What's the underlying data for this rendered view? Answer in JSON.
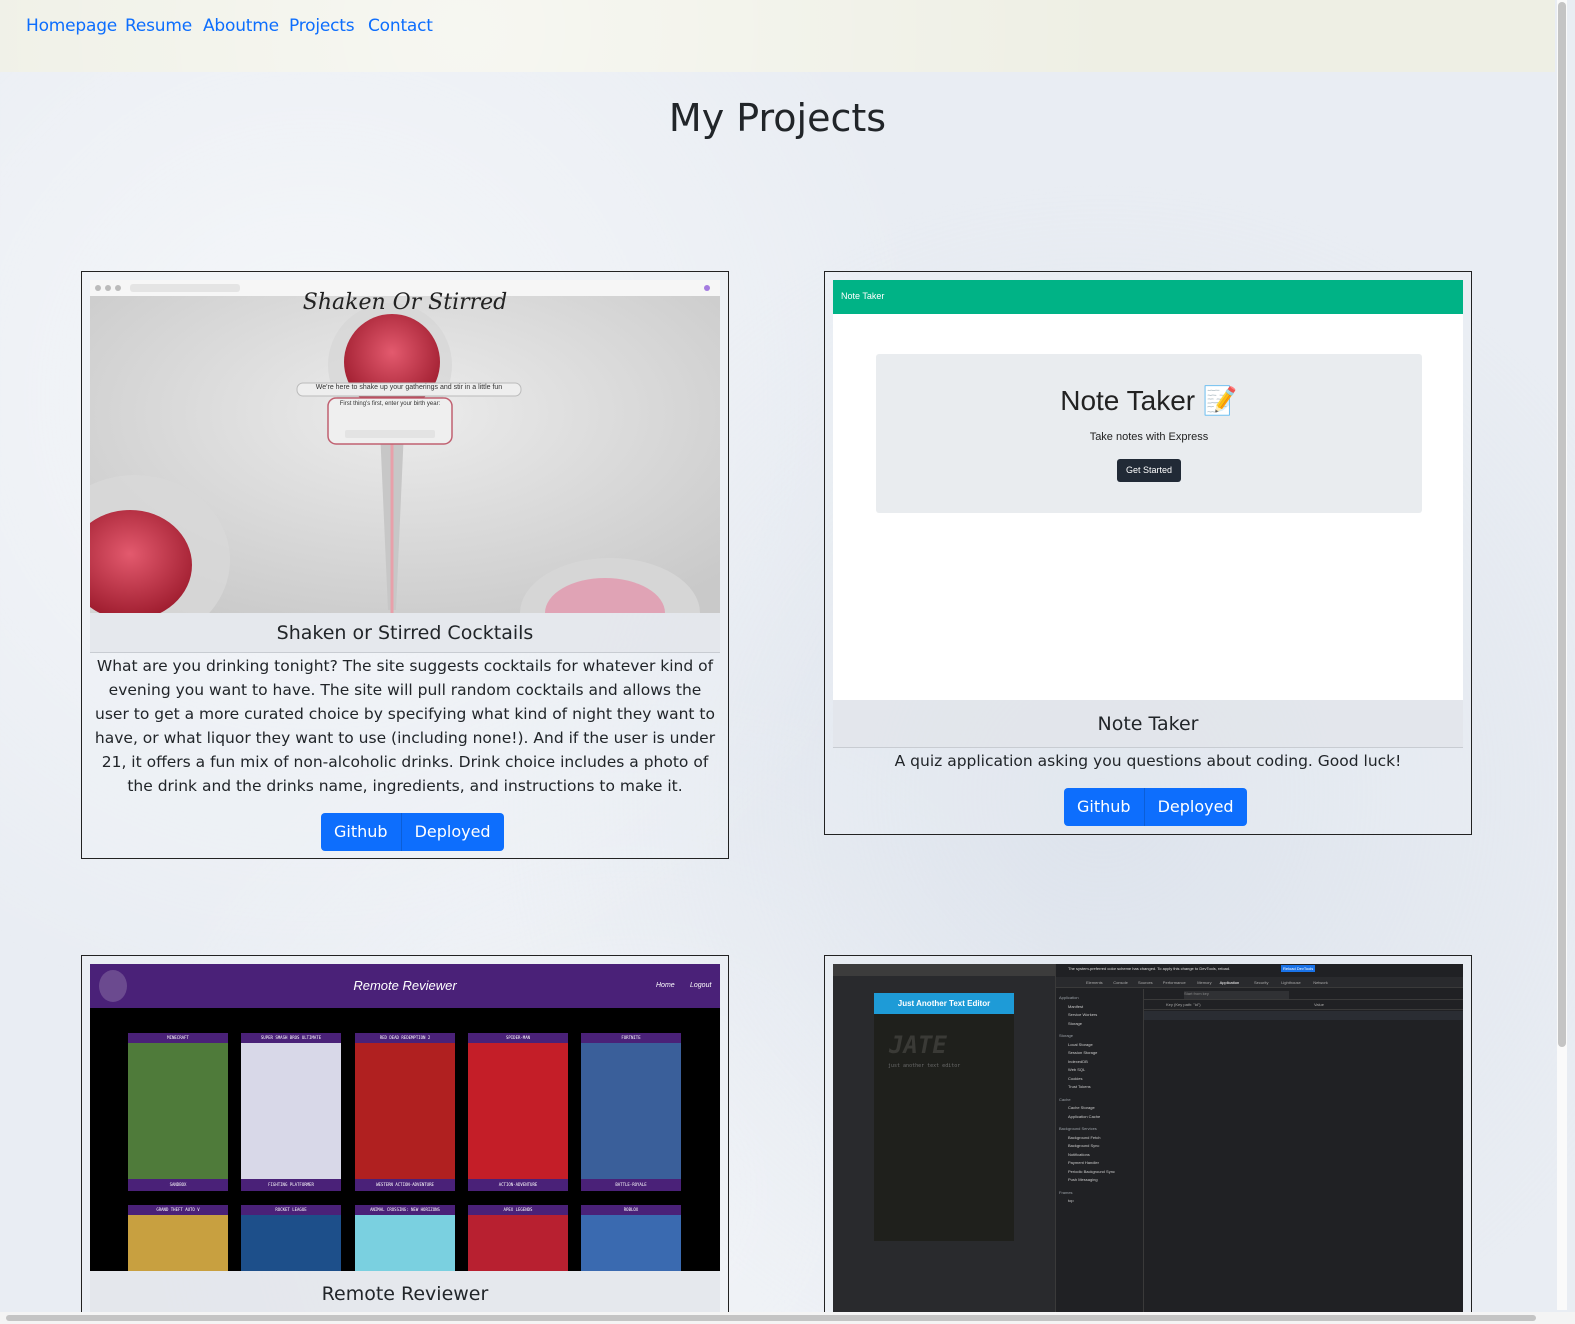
{
  "nav": {
    "links": [
      "Homepage",
      "Resume",
      "Aboutme",
      "Projects",
      "Contact"
    ]
  },
  "page": {
    "title": "My Projects"
  },
  "projects": [
    {
      "title": "Shaken or Stirred Cocktails",
      "description": "What are you drinking tonight? The site suggests cocktails for whatever kind of evening you want to have. The site will pull random cocktails and allows the user to get a more curated choice by specifying what kind of night they want to have, or what liquor they want to use (including none!). And if the user is under 21, it offers a fun mix of non-alcoholic drinks. Drink choice includes a photo of the drink and the drinks name, ingredients, and instructions to make it.",
      "github_label": "Github",
      "deployed_label": "Deployed",
      "screenshot": {
        "heading": "Shaken Or Stirred",
        "tagline": "We're here to shake up your gatherings and stir in a little fun",
        "prompt": "First thing's first, enter your birth year:"
      }
    },
    {
      "title": "Note Taker",
      "description": "A quiz application asking you questions about coding. Good luck!",
      "github_label": "Github",
      "deployed_label": "Deployed",
      "screenshot": {
        "navbar_label": "Note Taker",
        "heading": "Note Taker 📝",
        "subtitle": "Take notes with Express",
        "button": "Get Started",
        "accent_color": "#00b386"
      }
    },
    {
      "title": "Remote Reviewer",
      "screenshot": {
        "heading": "Remote Reviewer",
        "nav_home": "Home",
        "nav_logout": "Logout",
        "games_row1": [
          "MINECRAFT",
          "SUPER SMASH BROS ULTIMATE",
          "RED DEAD REDEMPTION 2",
          "SPIDER-MAN",
          "FORTNITE"
        ],
        "games_row1_genres": [
          "SANDBOX",
          "FIGHTING PLATFORMER",
          "WESTERN ACTION-ADVENTURE",
          "ACTION-ADVENTURE",
          "BATTLE-ROYALE"
        ],
        "games_row2": [
          "GRAND THEFT AUTO V",
          "ROCKET LEAGUE",
          "ANIMAL CROSSING: NEW HORIZONS",
          "APEX LEGENDS",
          "ROBLOX"
        ],
        "accent_color": "#4a2178"
      }
    },
    {
      "title": "",
      "screenshot": {
        "app_heading": "Just Another Text Editor",
        "banner": "The system-preferred color scheme has changed. To apply this change to DevTools, reload.",
        "reload_button": "Reload DevTools",
        "tabs": [
          "Elements",
          "Console",
          "Sources",
          "Performance",
          "Memory",
          "Application",
          "Security",
          "Lighthouse",
          "Network"
        ],
        "sidebar_sections": [
          "Application",
          "Storage",
          "Cache",
          "Background Services",
          "Frames"
        ],
        "sidebar_items": [
          "Manifest",
          "Service Workers",
          "Storage",
          "Local Storage",
          "Session Storage",
          "IndexedDB",
          "Web SQL",
          "Cookies",
          "Trust Tokens",
          "Cache Storage",
          "Application Cache",
          "Background Fetch",
          "Background Sync",
          "Notifications",
          "Payment Handler",
          "Periodic Background Sync",
          "Push Messaging",
          "top"
        ],
        "editor_text": "just another text editor",
        "table_headers": [
          "Key (Key path: \"id\")",
          "Value"
        ],
        "filter_placeholder": "Start from key"
      }
    }
  ]
}
